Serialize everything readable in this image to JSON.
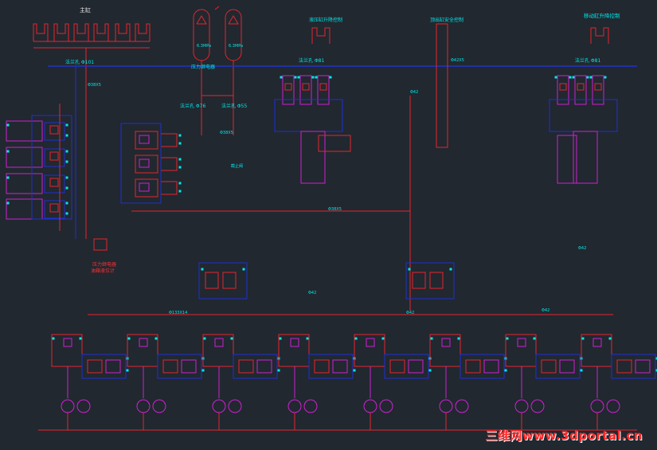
{
  "diagram": {
    "colors": {
      "background": "#212830",
      "pipe_red": "#e8242c",
      "pipe_blue": "#2030d0",
      "component_magenta": "#d020d0",
      "terminal_cyan": "#00e8e8",
      "text_white": "#e8e8e8"
    },
    "labels": {
      "main_top": "主缸",
      "accumulator_1": "6.3MPa",
      "accumulator_2": "6.3MPa",
      "pressure_relay": "压力继电器",
      "flange_1": "法兰孔 Φ101",
      "flange_2": "法兰孔 Φ76",
      "flange_3": "法兰孔 Φ55",
      "flange_4": "法兰孔 Φ81",
      "flange_5": "法兰孔 Φ81",
      "valve_unit_1": "液压缸升降控制",
      "valve_unit_2": "顶出缸安全控制",
      "valve_unit_3": "移动缸升降控制",
      "pipe_top_left": "Φ38X5",
      "pipe_mid_1": "Φ38X5",
      "pipe_right_top": "Φ42X5",
      "pipe_long": "Φ38X5",
      "pipe_bottom_1": "Φ133X14",
      "pipe_bottom_2": "Φ42",
      "pipe_bottom_3": "Φ42",
      "pipe_mid_right": "Φ42",
      "pipe_right": "Φ42",
      "pipe_center": "Φ42",
      "valve_left": "截止阀",
      "relief_label_1": "压力继电器",
      "relief_label_2": "油箱液位计",
      "watermark": "三维网www.3dportal.cn"
    }
  }
}
